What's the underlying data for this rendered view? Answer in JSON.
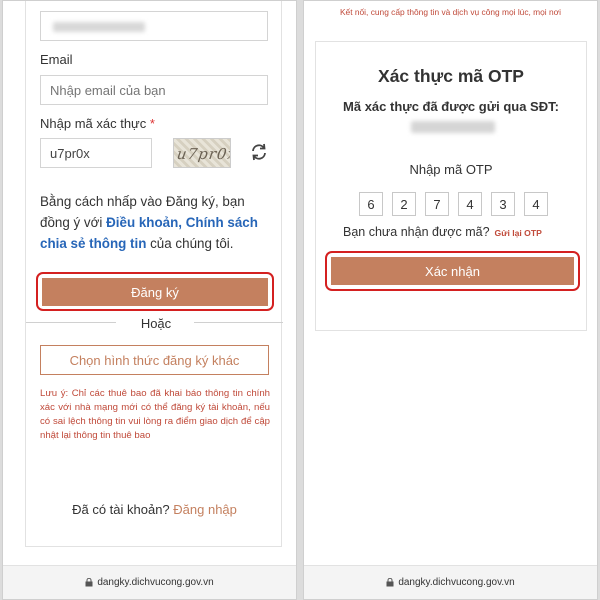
{
  "left": {
    "email_label": "Email",
    "email_placeholder": "Nhập email của bạn",
    "captcha_label": "Nhập mã xác thực",
    "captcha_required_mark": "*",
    "captcha_value": "u7pr0x",
    "captcha_image_text": "u7pr0x",
    "terms_prefix": "Bằng cách nhấp vào Đăng ký, bạn đồng ý với ",
    "terms_link": "Điều khoản, Chính sách chia sẻ thông tin",
    "terms_suffix": " của chúng tôi.",
    "register_button": "Đăng ký",
    "or_text": "Hoặc",
    "alt_register_button": "Chọn hình thức đăng ký khác",
    "note": "Lưu ý: Chỉ các thuê bao đã khai báo thông tin chính xác với nhà mạng mới có thể đăng ký tài khoản, nếu có sai lệch thông tin vui lòng ra điểm giao dịch để cập nhật lại thông tin thuê bao",
    "login_prompt": "Đã có tài khoản? ",
    "login_link": "Đăng nhập",
    "url": "dangky.dichvucong.gov.vn"
  },
  "right": {
    "header_text": "Kết nối, cung cấp thông tin và dịch vụ công mọi lúc, mọi nơi",
    "title": "Xác thực mã OTP",
    "subtitle": "Mã xác thực đã được gửi qua SĐT:",
    "otp_label": "Nhập mã OTP",
    "otp_digits": [
      "6",
      "2",
      "7",
      "4",
      "3",
      "4"
    ],
    "resend_prompt": "Bạn chưa nhận được mã?",
    "resend_link": "Gửi lại OTP",
    "confirm_button": "Xác nhận",
    "url": "dangky.dichvucong.gov.vn"
  },
  "colors": {
    "accent": "#c4805f",
    "link_blue": "#2766b8",
    "note_red": "#c04a3a",
    "highlight_red": "#d42020"
  }
}
